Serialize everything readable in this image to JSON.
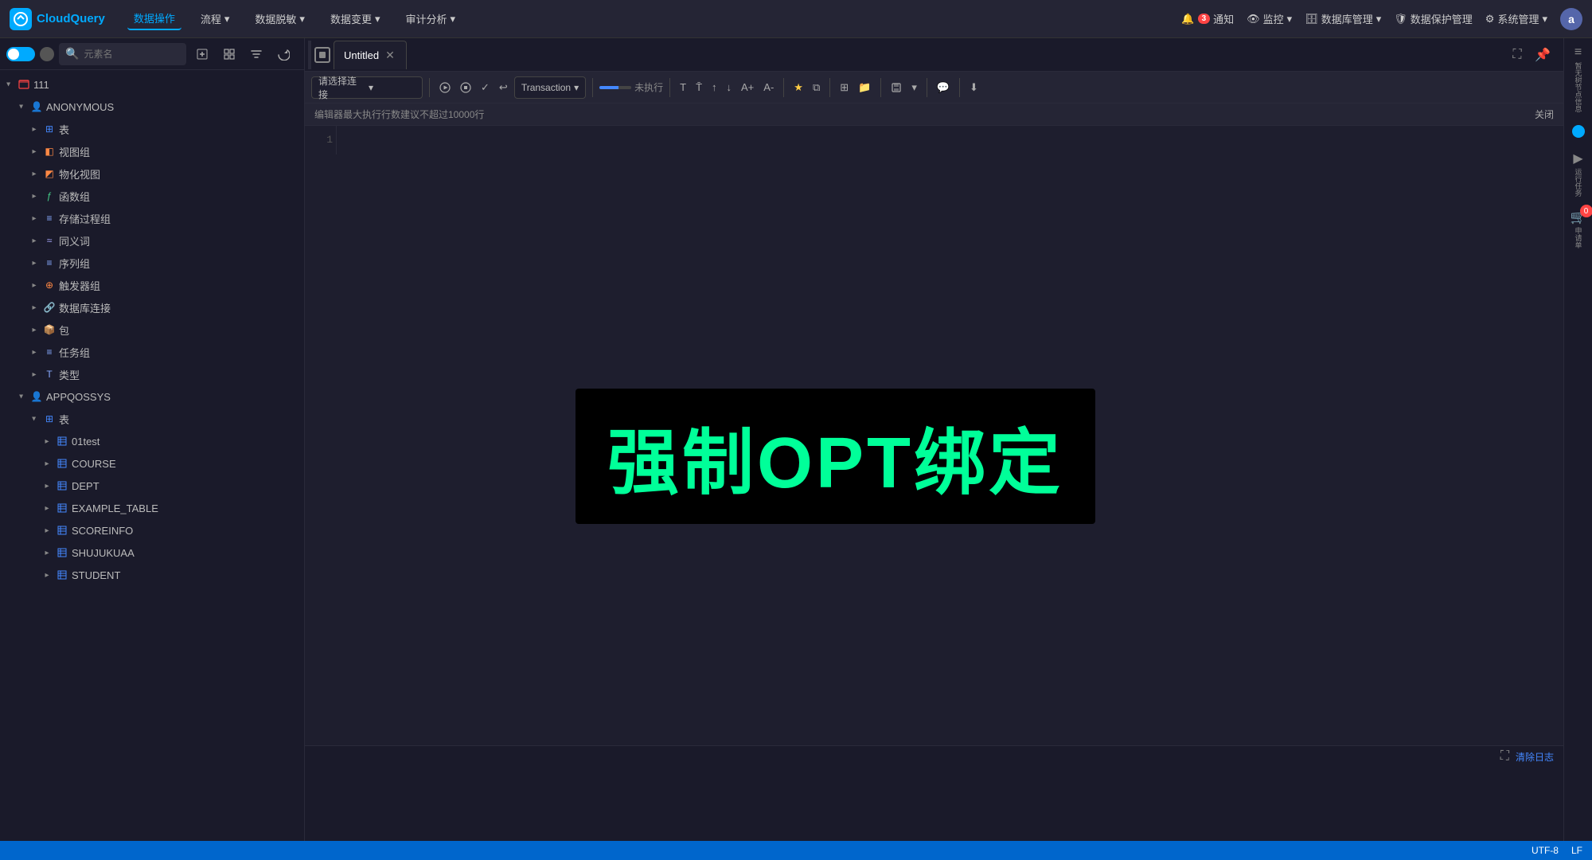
{
  "app": {
    "name": "CloudQuery"
  },
  "topnav": {
    "logo": "CloudQuery",
    "items": [
      {
        "label": "数据操作",
        "active": true
      },
      {
        "label": "流程",
        "dropdown": true
      },
      {
        "label": "数据脱敏",
        "dropdown": true
      },
      {
        "label": "数据变更",
        "dropdown": true
      },
      {
        "label": "审计分析",
        "dropdown": true
      }
    ],
    "right_items": [
      {
        "label": "通知",
        "badge": "3",
        "icon": "🔔"
      },
      {
        "label": "监控",
        "icon": "👁",
        "dropdown": true
      },
      {
        "label": "数据库管理",
        "icon": "🗄",
        "dropdown": true
      },
      {
        "label": "数据保护管理",
        "icon": "🛡"
      },
      {
        "label": "系统管理",
        "icon": "⚙",
        "dropdown": true
      }
    ],
    "avatar": "a"
  },
  "sidebar": {
    "search_placeholder": "元素名",
    "tree": [
      {
        "id": "db111",
        "label": "111",
        "level": 0,
        "type": "db",
        "open": true
      },
      {
        "id": "anon",
        "label": "ANONYMOUS",
        "level": 1,
        "type": "user",
        "open": true
      },
      {
        "id": "table-group",
        "label": "表",
        "level": 2,
        "type": "table-group"
      },
      {
        "id": "view-group",
        "label": "视图组",
        "level": 2,
        "type": "view"
      },
      {
        "id": "mview-group",
        "label": "物化视图",
        "level": 2,
        "type": "mview"
      },
      {
        "id": "func-group",
        "label": "函数组",
        "level": 2,
        "type": "func"
      },
      {
        "id": "proc-group",
        "label": "存储过程组",
        "level": 2,
        "type": "proc"
      },
      {
        "id": "syn-group",
        "label": "同义词",
        "level": 2,
        "type": "syn"
      },
      {
        "id": "seq-group",
        "label": "序列组",
        "level": 2,
        "type": "seq"
      },
      {
        "id": "trig-group",
        "label": "触发器组",
        "level": 2,
        "type": "trig"
      },
      {
        "id": "link-group",
        "label": "数据库连接",
        "level": 2,
        "type": "link"
      },
      {
        "id": "pkg-group",
        "label": "包",
        "level": 2,
        "type": "pkg"
      },
      {
        "id": "task-group",
        "label": "任务组",
        "level": 2,
        "type": "task"
      },
      {
        "id": "type-group",
        "label": "类型",
        "level": 2,
        "type": "type"
      },
      {
        "id": "appq",
        "label": "APPQOSSYS",
        "level": 1,
        "type": "user",
        "open": true
      },
      {
        "id": "appq-tables",
        "label": "表",
        "level": 2,
        "type": "table-group",
        "open": true
      },
      {
        "id": "01test",
        "label": "01test",
        "level": 3,
        "type": "tbl-row"
      },
      {
        "id": "course",
        "label": "COURSE",
        "level": 3,
        "type": "tbl-row"
      },
      {
        "id": "dept",
        "label": "DEPT",
        "level": 3,
        "type": "tbl-row"
      },
      {
        "id": "example",
        "label": "EXAMPLE_TABLE",
        "level": 3,
        "type": "tbl-row"
      },
      {
        "id": "scoreinfo",
        "label": "SCOREINFO",
        "level": 3,
        "type": "tbl-row"
      },
      {
        "id": "shujukuaa",
        "label": "SHUJUKUAA",
        "level": 3,
        "type": "tbl-row"
      },
      {
        "id": "student",
        "label": "STUDENT",
        "level": 3,
        "type": "tbl-row"
      }
    ]
  },
  "tabs": [
    {
      "label": "Untitled",
      "active": true
    }
  ],
  "editor": {
    "connection_placeholder": "请选择连接",
    "status": "未执行",
    "transaction_label": "Transaction",
    "info_message": "编辑器最大执行行数建议不超过10000行",
    "close_label": "关闭",
    "line_numbers": [
      "1"
    ]
  },
  "overlay": {
    "text": "强制OPT绑定"
  },
  "output": {
    "clear_label": "清除日志"
  },
  "right_sidebar": {
    "items": [
      {
        "label": "暂无树节点信息",
        "icon": "≡"
      },
      {
        "label": "运行任务",
        "icon": "▶",
        "badge": ""
      },
      {
        "label": "申请单",
        "icon": "📋",
        "badge": "0"
      }
    ]
  },
  "statusbar": {
    "encoding": "UTF-8",
    "line_ending": "LF"
  }
}
